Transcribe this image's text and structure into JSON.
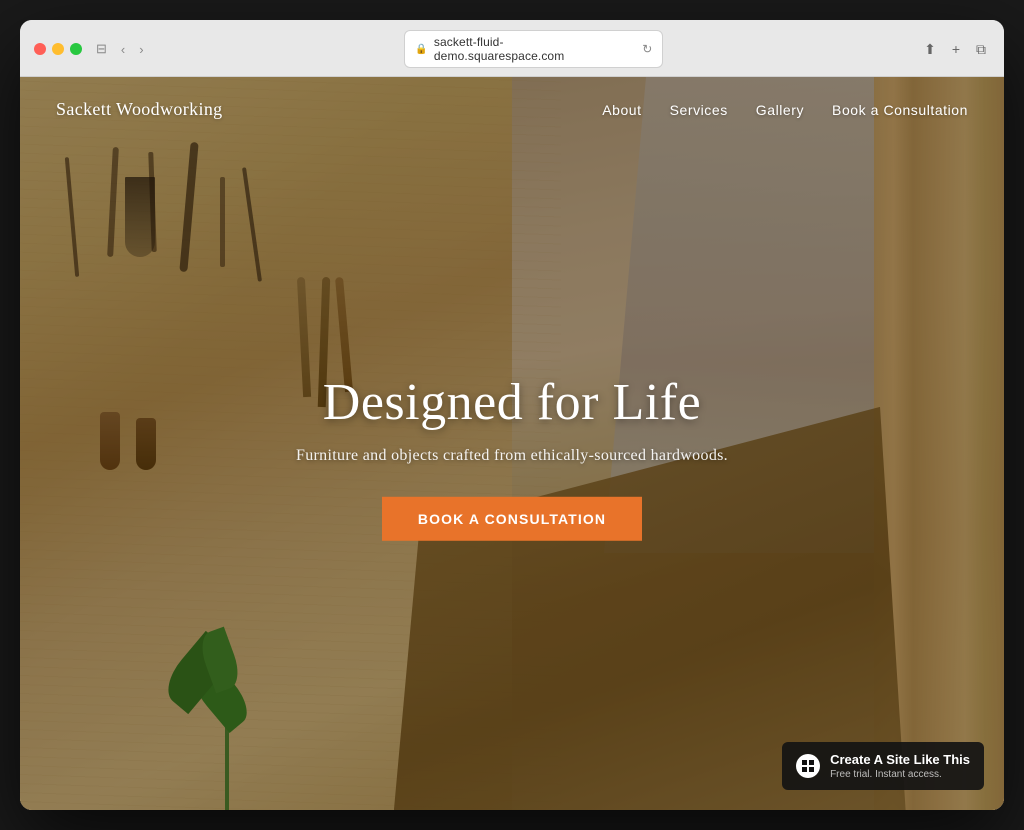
{
  "browser": {
    "url": "sackett-fluid-demo.squarespace.com",
    "controls": {
      "back": "‹",
      "forward": "›"
    }
  },
  "site": {
    "logo": "Sackett Woodworking",
    "nav": [
      {
        "id": "about",
        "label": "About"
      },
      {
        "id": "services",
        "label": "Services"
      },
      {
        "id": "gallery",
        "label": "Gallery"
      },
      {
        "id": "book",
        "label": "Book a Consultation"
      }
    ],
    "hero": {
      "title": "Designed for Life",
      "subtitle": "Furniture and objects crafted from ethically-sourced hardwoods.",
      "cta_label": "Book a Consultation"
    },
    "badge": {
      "main": "Create A Site Like This",
      "sub": "Free trial. Instant access.",
      "icon": "◼"
    }
  },
  "colors": {
    "accent": "#e8732a",
    "badge_bg": "rgba(20,20,20,0.92)",
    "nav_text": "#ffffff",
    "hero_overlay": "rgba(40,28,10,0.38)"
  }
}
